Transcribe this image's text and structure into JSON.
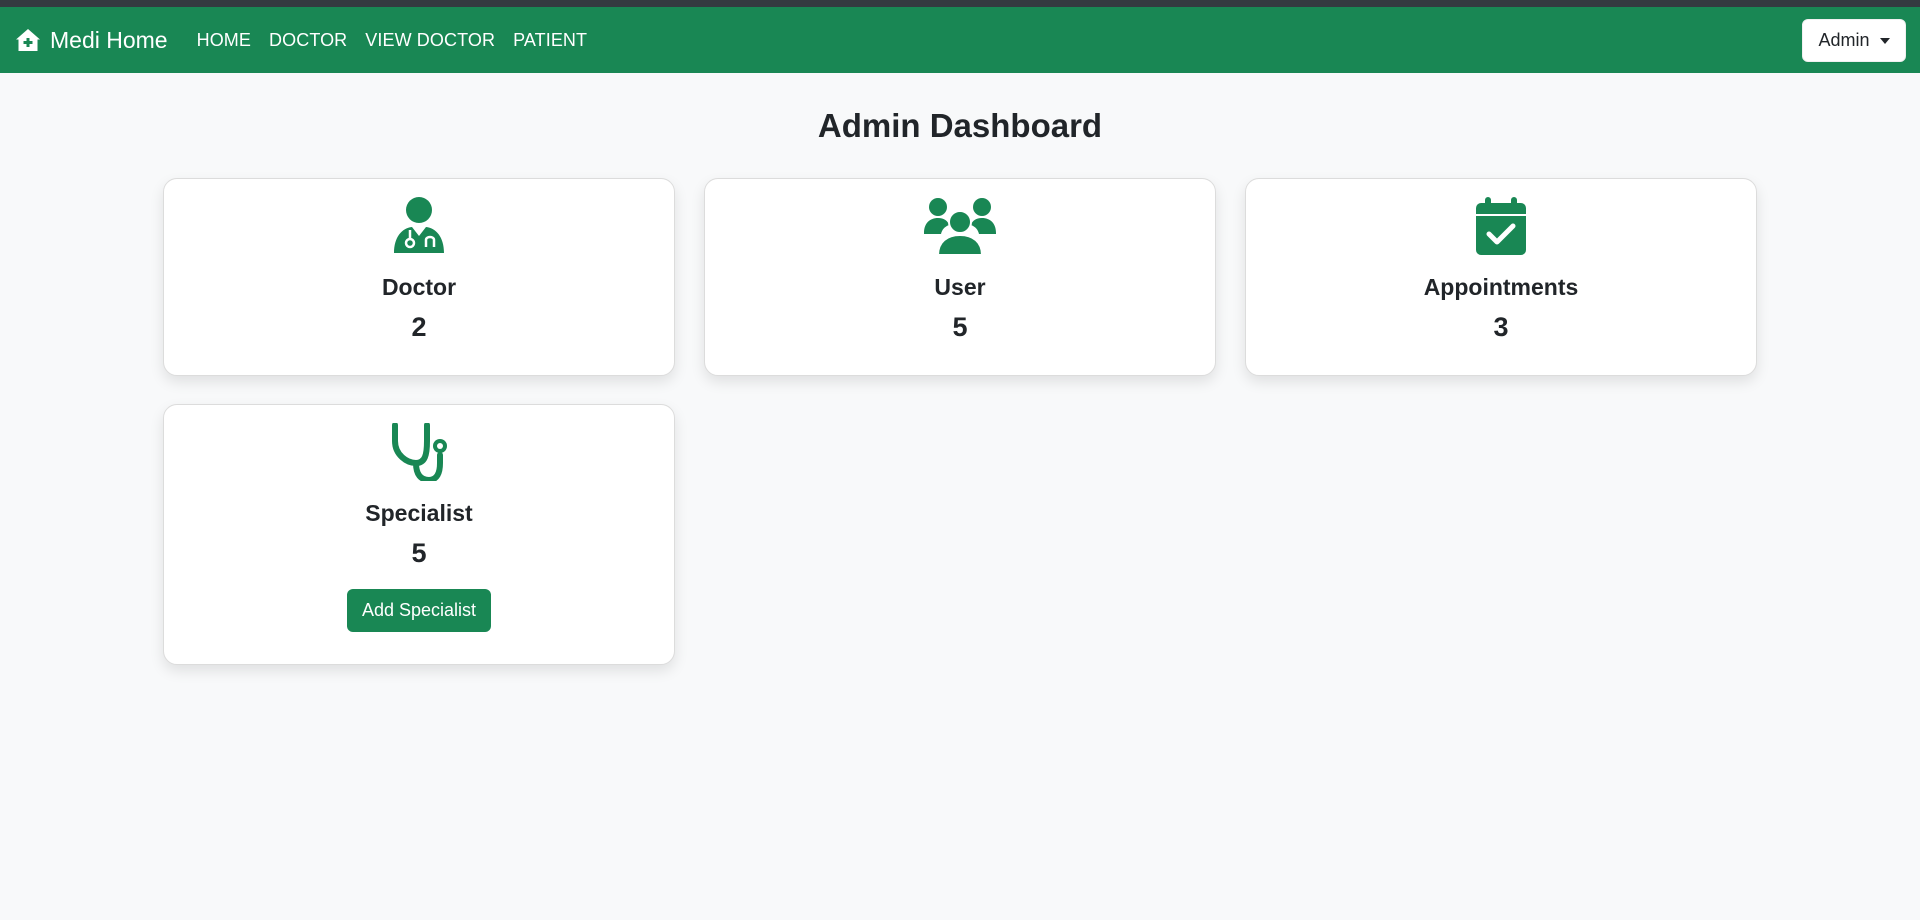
{
  "navbar": {
    "brand": "Medi Home",
    "links": [
      "HOME",
      "DOCTOR",
      "VIEW DOCTOR",
      "PATIENT"
    ],
    "user_menu": "Admin"
  },
  "page": {
    "title": "Admin Dashboard"
  },
  "cards": [
    {
      "icon": "doctor-icon",
      "title": "Doctor",
      "count": "2"
    },
    {
      "icon": "users-icon",
      "title": "User",
      "count": "5"
    },
    {
      "icon": "calendar-check-icon",
      "title": "Appointments",
      "count": "3"
    },
    {
      "icon": "stethoscope-icon",
      "title": "Specialist",
      "count": "5",
      "button": "Add Specialist"
    }
  ],
  "colors": {
    "primary": "#198754",
    "background": "#f8f9fa",
    "text": "#212529"
  }
}
